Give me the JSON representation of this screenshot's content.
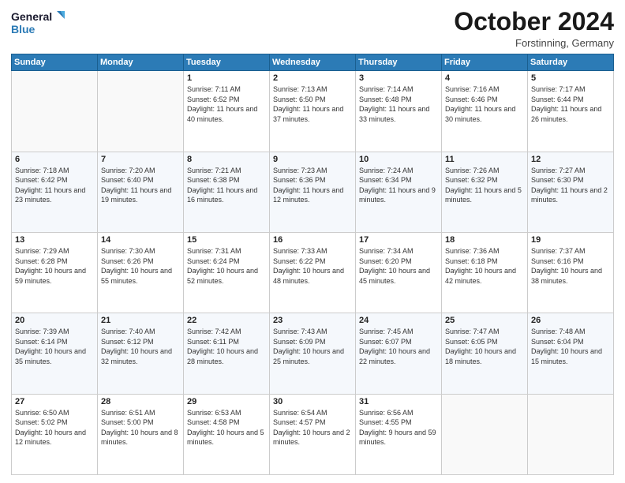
{
  "logo": {
    "line1": "General",
    "line2": "Blue"
  },
  "title": "October 2024",
  "location": "Forstinning, Germany",
  "days_header": [
    "Sunday",
    "Monday",
    "Tuesday",
    "Wednesday",
    "Thursday",
    "Friday",
    "Saturday"
  ],
  "weeks": [
    [
      {
        "day": "",
        "info": ""
      },
      {
        "day": "",
        "info": ""
      },
      {
        "day": "1",
        "info": "Sunrise: 7:11 AM\nSunset: 6:52 PM\nDaylight: 11 hours and 40 minutes."
      },
      {
        "day": "2",
        "info": "Sunrise: 7:13 AM\nSunset: 6:50 PM\nDaylight: 11 hours and 37 minutes."
      },
      {
        "day": "3",
        "info": "Sunrise: 7:14 AM\nSunset: 6:48 PM\nDaylight: 11 hours and 33 minutes."
      },
      {
        "day": "4",
        "info": "Sunrise: 7:16 AM\nSunset: 6:46 PM\nDaylight: 11 hours and 30 minutes."
      },
      {
        "day": "5",
        "info": "Sunrise: 7:17 AM\nSunset: 6:44 PM\nDaylight: 11 hours and 26 minutes."
      }
    ],
    [
      {
        "day": "6",
        "info": "Sunrise: 7:18 AM\nSunset: 6:42 PM\nDaylight: 11 hours and 23 minutes."
      },
      {
        "day": "7",
        "info": "Sunrise: 7:20 AM\nSunset: 6:40 PM\nDaylight: 11 hours and 19 minutes."
      },
      {
        "day": "8",
        "info": "Sunrise: 7:21 AM\nSunset: 6:38 PM\nDaylight: 11 hours and 16 minutes."
      },
      {
        "day": "9",
        "info": "Sunrise: 7:23 AM\nSunset: 6:36 PM\nDaylight: 11 hours and 12 minutes."
      },
      {
        "day": "10",
        "info": "Sunrise: 7:24 AM\nSunset: 6:34 PM\nDaylight: 11 hours and 9 minutes."
      },
      {
        "day": "11",
        "info": "Sunrise: 7:26 AM\nSunset: 6:32 PM\nDaylight: 11 hours and 5 minutes."
      },
      {
        "day": "12",
        "info": "Sunrise: 7:27 AM\nSunset: 6:30 PM\nDaylight: 11 hours and 2 minutes."
      }
    ],
    [
      {
        "day": "13",
        "info": "Sunrise: 7:29 AM\nSunset: 6:28 PM\nDaylight: 10 hours and 59 minutes."
      },
      {
        "day": "14",
        "info": "Sunrise: 7:30 AM\nSunset: 6:26 PM\nDaylight: 10 hours and 55 minutes."
      },
      {
        "day": "15",
        "info": "Sunrise: 7:31 AM\nSunset: 6:24 PM\nDaylight: 10 hours and 52 minutes."
      },
      {
        "day": "16",
        "info": "Sunrise: 7:33 AM\nSunset: 6:22 PM\nDaylight: 10 hours and 48 minutes."
      },
      {
        "day": "17",
        "info": "Sunrise: 7:34 AM\nSunset: 6:20 PM\nDaylight: 10 hours and 45 minutes."
      },
      {
        "day": "18",
        "info": "Sunrise: 7:36 AM\nSunset: 6:18 PM\nDaylight: 10 hours and 42 minutes."
      },
      {
        "day": "19",
        "info": "Sunrise: 7:37 AM\nSunset: 6:16 PM\nDaylight: 10 hours and 38 minutes."
      }
    ],
    [
      {
        "day": "20",
        "info": "Sunrise: 7:39 AM\nSunset: 6:14 PM\nDaylight: 10 hours and 35 minutes."
      },
      {
        "day": "21",
        "info": "Sunrise: 7:40 AM\nSunset: 6:12 PM\nDaylight: 10 hours and 32 minutes."
      },
      {
        "day": "22",
        "info": "Sunrise: 7:42 AM\nSunset: 6:11 PM\nDaylight: 10 hours and 28 minutes."
      },
      {
        "day": "23",
        "info": "Sunrise: 7:43 AM\nSunset: 6:09 PM\nDaylight: 10 hours and 25 minutes."
      },
      {
        "day": "24",
        "info": "Sunrise: 7:45 AM\nSunset: 6:07 PM\nDaylight: 10 hours and 22 minutes."
      },
      {
        "day": "25",
        "info": "Sunrise: 7:47 AM\nSunset: 6:05 PM\nDaylight: 10 hours and 18 minutes."
      },
      {
        "day": "26",
        "info": "Sunrise: 7:48 AM\nSunset: 6:04 PM\nDaylight: 10 hours and 15 minutes."
      }
    ],
    [
      {
        "day": "27",
        "info": "Sunrise: 6:50 AM\nSunset: 5:02 PM\nDaylight: 10 hours and 12 minutes."
      },
      {
        "day": "28",
        "info": "Sunrise: 6:51 AM\nSunset: 5:00 PM\nDaylight: 10 hours and 8 minutes."
      },
      {
        "day": "29",
        "info": "Sunrise: 6:53 AM\nSunset: 4:58 PM\nDaylight: 10 hours and 5 minutes."
      },
      {
        "day": "30",
        "info": "Sunrise: 6:54 AM\nSunset: 4:57 PM\nDaylight: 10 hours and 2 minutes."
      },
      {
        "day": "31",
        "info": "Sunrise: 6:56 AM\nSunset: 4:55 PM\nDaylight: 9 hours and 59 minutes."
      },
      {
        "day": "",
        "info": ""
      },
      {
        "day": "",
        "info": ""
      }
    ]
  ]
}
